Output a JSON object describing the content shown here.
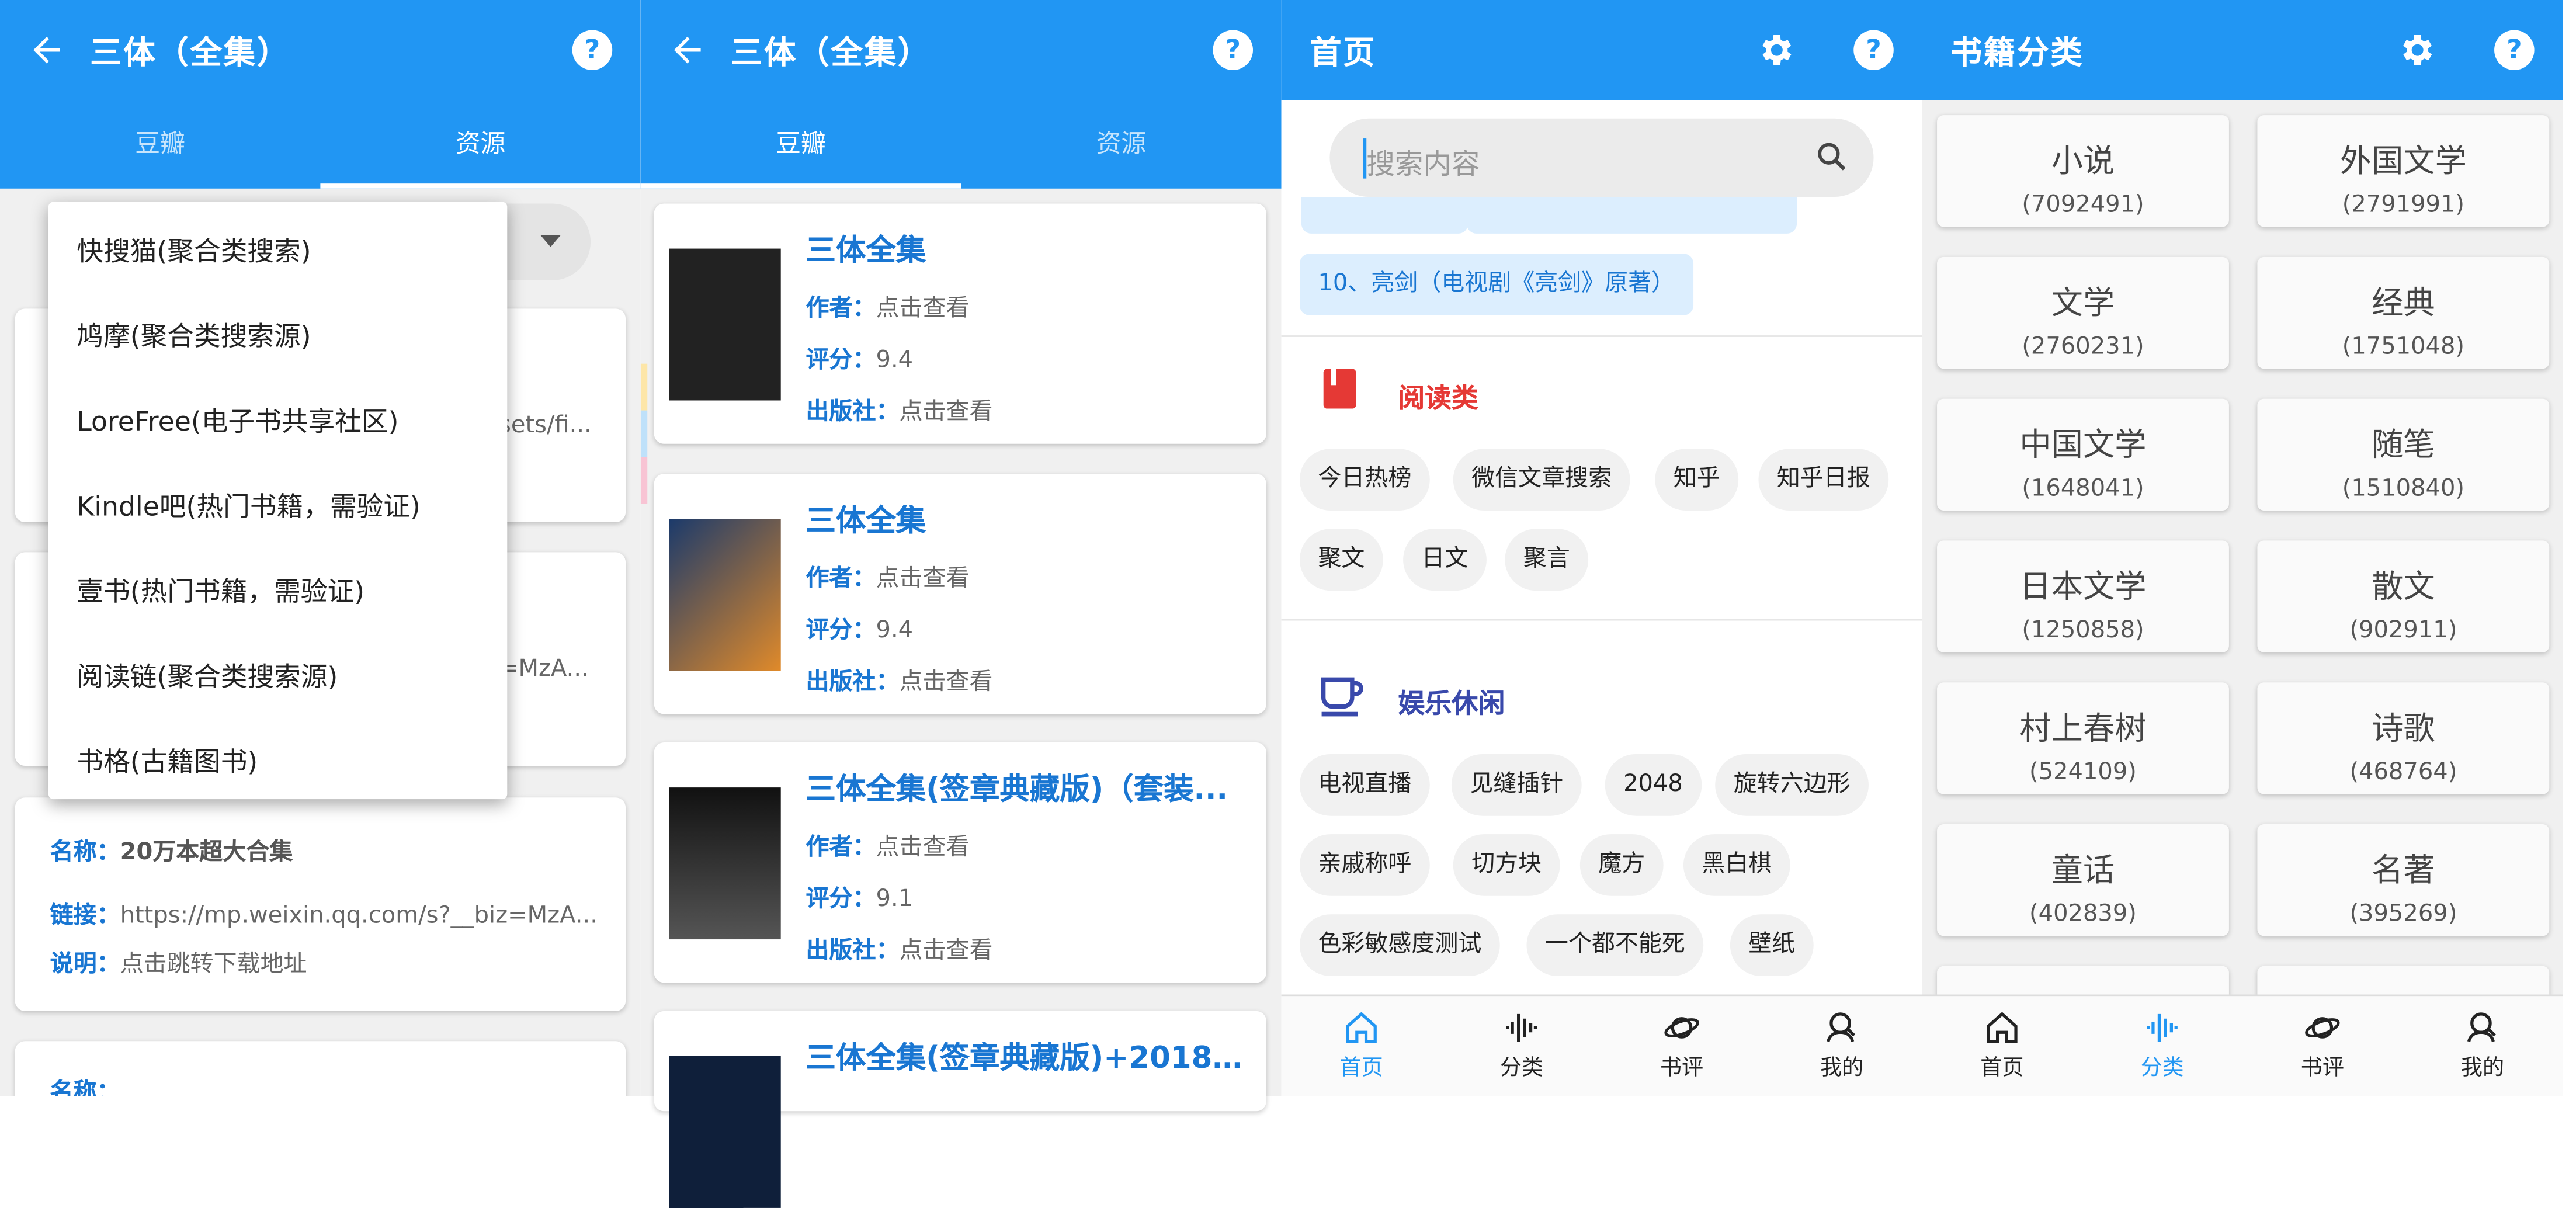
{
  "colors": {
    "primary": "#2196f3",
    "link": "#1976d2",
    "read_accent": "#e53935",
    "fun_accent": "#3949ab"
  },
  "panel1": {
    "title": "三体（全集）",
    "tabs": [
      "豆瓣",
      "资源"
    ],
    "active_tab": 1,
    "menu": [
      "快搜猫(聚合类搜索)",
      "鸠摩(聚合类搜索源)",
      "LoreFree(电子书共享社区)",
      "Kindle吧(热门书籍，需验证)",
      "壹书(热门书籍，需验证)",
      "阅读链(聚合类搜索源)",
      "书格(古籍图书)"
    ],
    "behind_fragments": [
      "sets/fi...",
      "=MzA..."
    ],
    "resource": {
      "name_label": "名称：",
      "name": "20万本超大合集",
      "link_label": "链接：",
      "link": "https://mp.weixin.qq.com/s?__biz=MzA...",
      "desc_label": "说明：",
      "desc": "点击跳转下载地址"
    },
    "partial_label": "名称："
  },
  "panel2": {
    "title": "三体（全集）",
    "tabs": [
      "豆瓣",
      "资源"
    ],
    "active_tab": 0,
    "labels": {
      "author": "作者：",
      "rating": "评分：",
      "publisher": "出版社："
    },
    "books": [
      {
        "title": "三体全集",
        "author": "点击查看",
        "rating": "9.4",
        "publisher": "点击查看"
      },
      {
        "title": "三体全集",
        "author": "点击查看",
        "rating": "9.4",
        "publisher": "点击查看"
      },
      {
        "title": "三体全集(签章典藏版)（套装...",
        "author": "点击查看",
        "rating": "9.1",
        "publisher": "点击查看"
      },
      {
        "title": "三体全集(签章典藏版)+2018(..."
      }
    ]
  },
  "panel3": {
    "title": "首页",
    "search_placeholder": "搜索内容",
    "blue_chip": "10、亮剑（电视剧《亮剑》原著）",
    "sections": [
      {
        "title": "阅读类",
        "icon": "book-icon",
        "chips": [
          [
            "今日热榜",
            "微信文章搜索",
            "知乎",
            "知乎日报"
          ],
          [
            "聚文",
            "日文",
            "聚言"
          ]
        ]
      },
      {
        "title": "娱乐休闲",
        "icon": "cup-icon",
        "chips": [
          [
            "电视直播",
            "见缝插针",
            "2048",
            "旋转六边形"
          ],
          [
            "亲戚称呼",
            "切方块",
            "魔方",
            "黑白棋"
          ],
          [
            "色彩敏感度测试",
            "一个都不能死",
            "壁纸"
          ]
        ]
      }
    ],
    "nav": [
      "首页",
      "分类",
      "书评",
      "我的"
    ],
    "active_nav": 0
  },
  "panel4": {
    "title": "书籍分类",
    "categories": [
      {
        "name": "小说",
        "count": "(7092491)"
      },
      {
        "name": "外国文学",
        "count": "(2791991)"
      },
      {
        "name": "文学",
        "count": "(2760231)"
      },
      {
        "name": "经典",
        "count": "(1751048)"
      },
      {
        "name": "中国文学",
        "count": "(1648041)"
      },
      {
        "name": "随笔",
        "count": "(1510840)"
      },
      {
        "name": "日本文学",
        "count": "(1250858)"
      },
      {
        "name": "散文",
        "count": "(902911)"
      },
      {
        "name": "村上春树",
        "count": "(524109)"
      },
      {
        "name": "诗歌",
        "count": "(468764)"
      },
      {
        "name": "童话",
        "count": "(402839)"
      },
      {
        "name": "名著",
        "count": "(395269)"
      }
    ],
    "nav": [
      "首页",
      "分类",
      "书评",
      "我的"
    ],
    "active_nav": 1
  }
}
